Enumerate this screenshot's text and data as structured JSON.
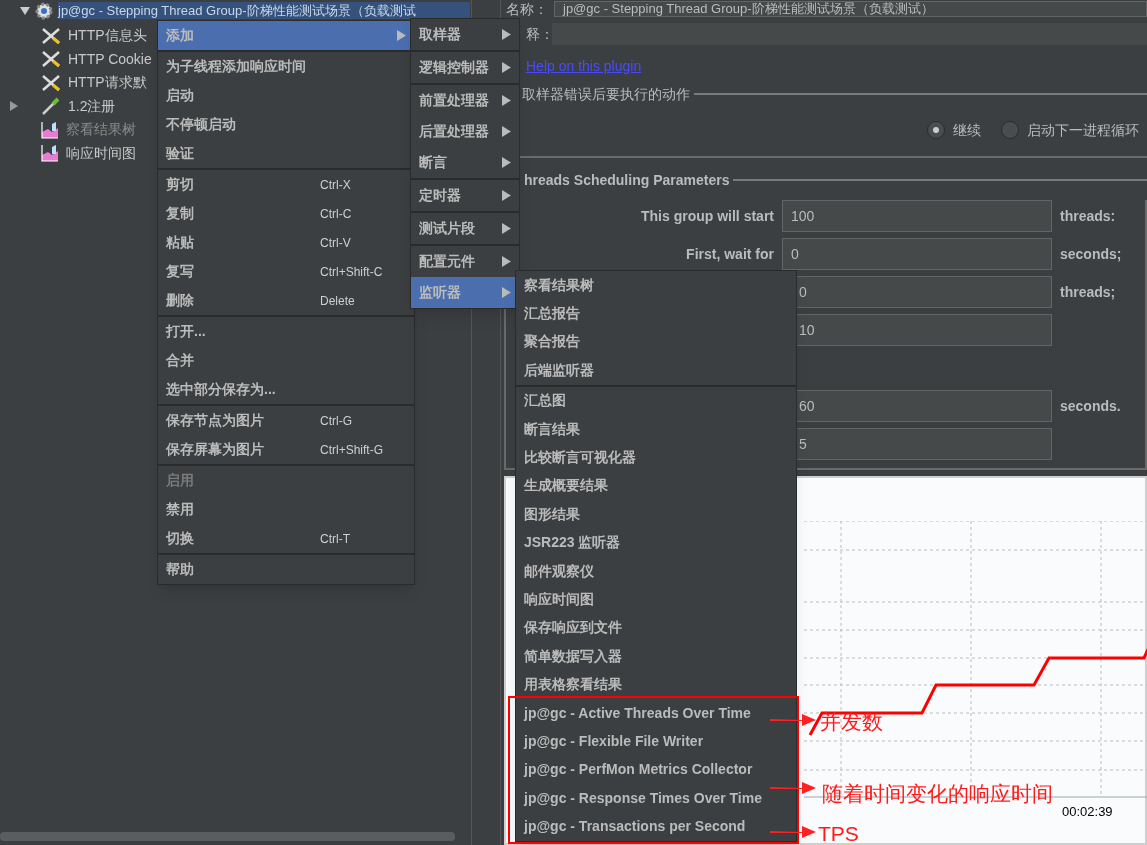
{
  "tree": {
    "items": [
      {
        "label": "jp@gc - Stepping Thread Group-阶梯性能测试场景（负载测试",
        "kind": "thread-group",
        "selected": true,
        "expanded": true,
        "children": [
          {
            "label": "HTTP信息头",
            "kind": "config",
            "selected": false,
            "disabled": false
          },
          {
            "label": "HTTP Cookie",
            "kind": "config",
            "selected": false,
            "disabled": false
          },
          {
            "label": "HTTP请求默",
            "kind": "config",
            "selected": false,
            "disabled": false
          },
          {
            "label": "1.2注册",
            "kind": "sampler",
            "selected": false,
            "expanded": false,
            "disabled": false
          },
          {
            "label": "察看结果树",
            "kind": "listener",
            "selected": false,
            "disabled": true
          },
          {
            "label": "响应时间图",
            "kind": "listener",
            "selected": false,
            "disabled": false
          }
        ]
      }
    ]
  },
  "form": {
    "name_label": "名称：",
    "name_value": "jp@gc - Stepping Thread Group-阶梯性能测试场景（负载测试）",
    "comment_label": "释：",
    "help_link": "Help on this plugin",
    "error_action": {
      "title": "取样器错误后要执行的动作",
      "options": [
        {
          "label": "继续",
          "selected": true
        },
        {
          "label": "启动下一进程循环",
          "selected": false
        }
      ]
    },
    "scheduling": {
      "title": "hreads Scheduling Parameters",
      "rows": [
        {
          "label": "This group will start",
          "value": "100",
          "unit": "threads:"
        },
        {
          "label": "First, wait for",
          "value": "0",
          "unit": "seconds;"
        },
        {
          "value": "0",
          "unit": "threads;"
        },
        {
          "value": "10"
        },
        {
          "value": "60",
          "unit": "seconds."
        },
        {
          "value": "5"
        }
      ]
    }
  },
  "chart": {
    "x_labels": [
      "00:02:39"
    ]
  },
  "context_menu": {
    "groups": [
      [
        {
          "label": "添加",
          "submenu": true,
          "selected": true,
          "disabled": false
        }
      ],
      [
        {
          "label": "为子线程添加响应时间",
          "selected": false,
          "disabled": false
        },
        {
          "label": "启动",
          "selected": false,
          "disabled": false
        },
        {
          "label": "不停顿启动",
          "selected": false,
          "disabled": false
        },
        {
          "label": "验证",
          "selected": false,
          "disabled": false
        }
      ],
      [
        {
          "label": "剪切",
          "shortcut": "Ctrl-X",
          "selected": false,
          "disabled": false
        },
        {
          "label": "复制",
          "shortcut": "Ctrl-C",
          "selected": false,
          "disabled": false
        },
        {
          "label": "粘贴",
          "shortcut": "Ctrl-V",
          "selected": false,
          "disabled": false
        },
        {
          "label": "复写",
          "shortcut": "Ctrl+Shift-C",
          "selected": false,
          "disabled": false
        },
        {
          "label": "删除",
          "shortcut": "Delete",
          "selected": false,
          "disabled": false
        }
      ],
      [
        {
          "label": "打开...",
          "selected": false,
          "disabled": false
        },
        {
          "label": "合并",
          "selected": false,
          "disabled": false
        },
        {
          "label": "选中部分保存为...",
          "selected": false,
          "disabled": false
        }
      ],
      [
        {
          "label": "保存节点为图片",
          "shortcut": "Ctrl-G",
          "selected": false,
          "disabled": false
        },
        {
          "label": "保存屏幕为图片",
          "shortcut": "Ctrl+Shift-G",
          "selected": false,
          "disabled": false
        }
      ],
      [
        {
          "label": "启用",
          "selected": false,
          "disabled": true
        },
        {
          "label": "禁用",
          "selected": false,
          "disabled": false
        },
        {
          "label": "切换",
          "shortcut": "Ctrl-T",
          "selected": false,
          "disabled": false
        }
      ],
      [
        {
          "label": "帮助",
          "selected": false,
          "disabled": false
        }
      ]
    ]
  },
  "add_submenu": {
    "groups": [
      [
        {
          "label": "取样器",
          "submenu": true,
          "selected": false
        }
      ],
      [
        {
          "label": "逻辑控制器",
          "submenu": true,
          "selected": false
        }
      ],
      [
        {
          "label": "前置处理器",
          "submenu": true,
          "selected": false
        },
        {
          "label": "后置处理器",
          "submenu": true,
          "selected": false
        },
        {
          "label": "断言",
          "submenu": true,
          "selected": false
        }
      ],
      [
        {
          "label": "定时器",
          "submenu": true,
          "selected": false
        }
      ],
      [
        {
          "label": "测试片段",
          "submenu": true,
          "selected": false
        }
      ],
      [
        {
          "label": "配置元件",
          "submenu": true,
          "selected": false
        },
        {
          "label": "监听器",
          "submenu": true,
          "selected": true
        }
      ]
    ]
  },
  "listener_submenu": {
    "groups": [
      [
        {
          "label": "察看结果树",
          "selected": false
        },
        {
          "label": "汇总报告",
          "selected": false
        },
        {
          "label": "聚合报告",
          "selected": false
        },
        {
          "label": "后端监听器",
          "selected": false
        }
      ],
      [
        {
          "label": "汇总图",
          "selected": false
        },
        {
          "label": "断言结果",
          "selected": false
        },
        {
          "label": "比较断言可视化器",
          "selected": false
        },
        {
          "label": "生成概要结果",
          "selected": false
        },
        {
          "label": "图形结果",
          "selected": false
        },
        {
          "label": "JSR223 监听器",
          "selected": false
        },
        {
          "label": "邮件观察仪",
          "selected": false
        },
        {
          "label": "响应时间图",
          "selected": false
        },
        {
          "label": "保存响应到文件",
          "selected": false
        },
        {
          "label": "简单数据写入器",
          "selected": false
        },
        {
          "label": "用表格察看结果",
          "selected": false
        },
        {
          "label": "jp@gc - Active Threads Over Time",
          "selected": false
        },
        {
          "label": "jp@gc - Flexible File Writer",
          "selected": false
        },
        {
          "label": "jp@gc - PerfMon Metrics Collector",
          "selected": false
        },
        {
          "label": "jp@gc - Response Times Over Time",
          "selected": false
        },
        {
          "label": "jp@gc - Transactions per Second",
          "selected": false
        }
      ]
    ]
  },
  "annotations": [
    {
      "text": "并发数"
    },
    {
      "text": "随着时间变化的响应时间"
    },
    {
      "text": "TPS"
    }
  ]
}
